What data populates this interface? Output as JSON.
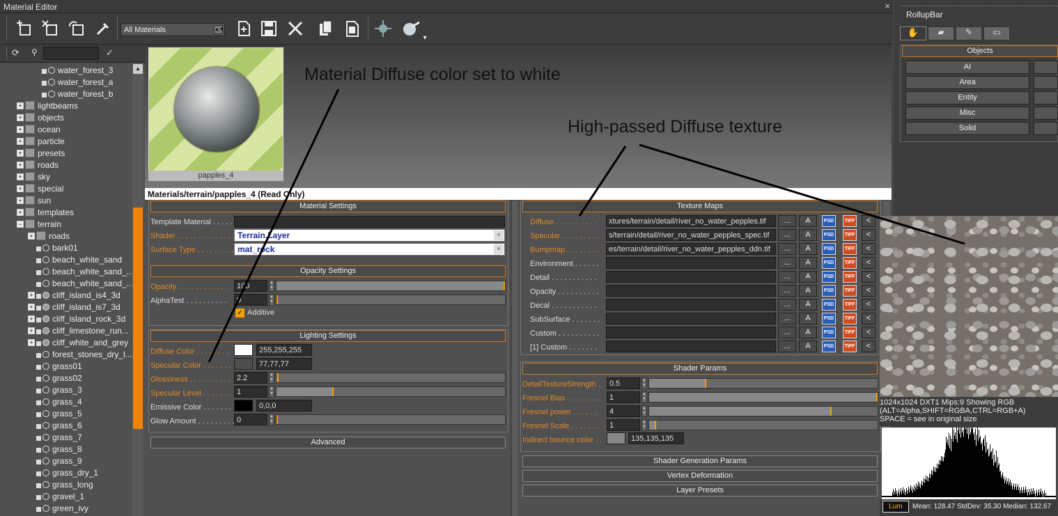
{
  "window": {
    "title": "Material Editor",
    "close_icon": "×"
  },
  "toolbar": {
    "filter_value": "All Materials"
  },
  "tree": {
    "items": [
      {
        "label": "water_forest_3",
        "kind": "mat"
      },
      {
        "label": "water_forest_a",
        "kind": "mat"
      },
      {
        "label": "water_forest_b",
        "kind": "mat"
      },
      {
        "label": "lightbeams",
        "kind": "folder"
      },
      {
        "label": "objects",
        "kind": "folder"
      },
      {
        "label": "ocean",
        "kind": "folder"
      },
      {
        "label": "particle",
        "kind": "folder"
      },
      {
        "label": "presets",
        "kind": "folder"
      },
      {
        "label": "roads",
        "kind": "folder"
      },
      {
        "label": "sky",
        "kind": "folder"
      },
      {
        "label": "special",
        "kind": "folder"
      },
      {
        "label": "sun",
        "kind": "folder"
      },
      {
        "label": "templates",
        "kind": "folder"
      },
      {
        "label": "terrain",
        "kind": "folder-open"
      },
      {
        "label": "roads",
        "kind": "subfolder"
      },
      {
        "label": "bark01",
        "kind": "mat2"
      },
      {
        "label": "beach_white_sand",
        "kind": "mat2"
      },
      {
        "label": "beach_white_sand_...",
        "kind": "mat2"
      },
      {
        "label": "beach_white_sand_...",
        "kind": "mat2"
      },
      {
        "label": "cliff_island_is4_3d",
        "kind": "group"
      },
      {
        "label": "cliff_island_is7_3d",
        "kind": "group"
      },
      {
        "label": "cliff_island_rock_3d",
        "kind": "group"
      },
      {
        "label": "cliff_limestone_run...",
        "kind": "group"
      },
      {
        "label": "cliff_white_and_grey",
        "kind": "group"
      },
      {
        "label": "forest_stones_dry_l...",
        "kind": "mat2"
      },
      {
        "label": "grass01",
        "kind": "mat2"
      },
      {
        "label": "grass02",
        "kind": "mat2"
      },
      {
        "label": "grass_3",
        "kind": "mat2"
      },
      {
        "label": "grass_4",
        "kind": "mat2"
      },
      {
        "label": "grass_5",
        "kind": "mat2"
      },
      {
        "label": "grass_6",
        "kind": "mat2"
      },
      {
        "label": "grass_7",
        "kind": "mat2"
      },
      {
        "label": "grass_8",
        "kind": "mat2"
      },
      {
        "label": "grass_9",
        "kind": "mat2"
      },
      {
        "label": "grass_dry_1",
        "kind": "mat2"
      },
      {
        "label": "grass_long",
        "kind": "mat2"
      },
      {
        "label": "gravel_1",
        "kind": "mat2"
      },
      {
        "label": "green_ivy",
        "kind": "mat2"
      }
    ]
  },
  "preview": {
    "material_name": "papples_4",
    "path": "Materials/terrain/papples_4 (Read Only)"
  },
  "material_settings": {
    "header": "Material Settings",
    "template_label": "Template Material . . . . .",
    "shader_label": "Shader . . . . . . . . . . . . . .",
    "shader_value": "Terrain.Layer",
    "surface_label": "Surface Type . . . . . . . . .",
    "surface_value": "mat_rock"
  },
  "opacity_settings": {
    "header": "Opacity Settings",
    "opacity_label": "Opacity . . . . . . . . . . . .",
    "opacity_value": "100",
    "opacity_fraction": 1.0,
    "alphatest_label": "AlphaTest . . . . . . . . . .",
    "alphatest_value": "0",
    "alphatest_fraction": 0.0,
    "additive_label": "Additive"
  },
  "lighting_settings": {
    "header": "Lighting Settings",
    "diffuse_label": "Diffuse Color . . . . . . . .",
    "diffuse_value": "255,255,255",
    "diffuse_color": "#ffffff",
    "specular_label": "Specular Color . . . . . . .",
    "specular_value": "77,77,77",
    "specular_color": "#4d4d4d",
    "gloss_label": "Glossiness . . . . . . . . . .",
    "gloss_value": "2.2",
    "gloss_fraction": 0.01,
    "speclevel_label": "Specular Level . . . . . . .",
    "speclevel_value": "1",
    "speclevel_fraction": 0.25,
    "emissive_label": "Emissive Color . . . . . . .",
    "emissive_value": "0,0,0",
    "emissive_color": "#000000",
    "glow_label": "Glow Amount . . . . . . . . .",
    "glow_value": "0",
    "glow_fraction": 0.0
  },
  "advanced": {
    "header": "Advanced"
  },
  "texture_maps": {
    "header": "Texture Maps",
    "btn_browse": "...",
    "btn_a": "A",
    "btn_psd": "PSD",
    "btn_tiff": "TIFF",
    "btn_back": "<",
    "slots": [
      {
        "label": "Diffuse . . . . . . . . . .",
        "path": "xtures/terrain/detail/river_no_water_pepples.tif",
        "active": true
      },
      {
        "label": "Specular . . . . . . . . .",
        "path": "s/terrain/detail/river_no_water_pepples_spec.tif",
        "active": true
      },
      {
        "label": "Bumpmap . . . . . . . .",
        "path": "es/terrain/detail/river_no_water_pepples_ddn.tif",
        "active": true
      },
      {
        "label": "Environment . . . . . .",
        "path": "",
        "active": false
      },
      {
        "label": "Detail . . . . . . . . . . .",
        "path": "",
        "active": false
      },
      {
        "label": "Opacity . . . . . . . . . .",
        "path": "",
        "active": false
      },
      {
        "label": "Decal . . . . . . . . . . .",
        "path": "",
        "active": false
      },
      {
        "label": "SubSurface . . . . . . .",
        "path": "",
        "active": false
      },
      {
        "label": "Custom . . . . . . . . . .",
        "path": "",
        "active": false
      },
      {
        "label": "[1] Custom . . . . . . .",
        "path": "",
        "active": false
      }
    ]
  },
  "shader_params": {
    "header": "Shader Params",
    "params": [
      {
        "label": "DetailTextureStrength .",
        "value": "0.5",
        "fraction": 0.25
      },
      {
        "label": "Fresnel Bias . . . . . . . .",
        "value": "1",
        "fraction": 1.0
      },
      {
        "label": "Fresnel power . . . . . .",
        "value": "4",
        "fraction": 0.8
      },
      {
        "label": "Fresnel Scale . . . . . . .",
        "value": "1",
        "fraction": 0.03
      }
    ],
    "bounce_label": "Indirect bounce color . .",
    "bounce_value": "135,135,135",
    "bounce_color": "#878787"
  },
  "collapsed_sections": {
    "gen": "Shader Generation Params",
    "vertex": "Vertex Deformation",
    "presets": "Layer Presets"
  },
  "rollup": {
    "title": "RollupBar",
    "objects_label": "Objects",
    "buttons": [
      "AI",
      "Area",
      "Entity",
      "Misc",
      "Solid"
    ]
  },
  "texture_info": {
    "line1": "1024x1024 DXT1 Mips:9 Showing RGB",
    "line2": "(ALT=Alpha,SHIFT=RGBA,CTRL=RGB+A)",
    "line3": "SPACE = see in original size",
    "lum_label": "Lum",
    "stats": "Mean: 128.47 StdDev: 35.30 Median: 132.67"
  },
  "annotations": {
    "diffuse_note": "Material Diffuse color set to white",
    "texture_note": "High-passed Diffuse texture"
  },
  "colors": {
    "accent": "#f0840a",
    "label_orange": "#e08a28"
  }
}
